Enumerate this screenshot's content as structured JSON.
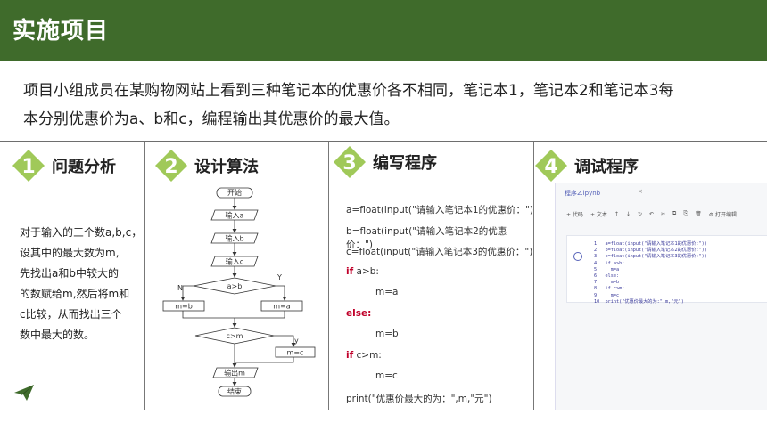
{
  "header": {
    "title": "实施项目"
  },
  "intro": {
    "line1": "项目小组成员在某购物网站上看到三种笔记本的优惠价各不相同，笔记本1，笔记本2和笔记本3每",
    "line2": "本分别优惠价为a、b和c，编程输出其优惠价的最大值。"
  },
  "sections": [
    {
      "number": "1",
      "label": "问题分析"
    },
    {
      "number": "2",
      "label": "设计算法"
    },
    {
      "number": "3",
      "label": "编写程序"
    },
    {
      "number": "4",
      "label": "调试程序"
    }
  ],
  "analysis": {
    "lines": [
      "对于输入的三个数a,b,c，",
      "设其中的最大数为m,",
      "先找出a和b中较大的",
      "的数赋给m,然后将m和",
      "c比较，从而找出三个",
      "数中最大的数。"
    ]
  },
  "flowchart": {
    "start": "开始",
    "input_a": "输入a",
    "input_b": "输入b",
    "input_c": "输入c",
    "cond1": "a>b",
    "yes1": "Y",
    "no1": "N",
    "assign_b": "m=b",
    "assign_a": "m=a",
    "cond2": "c>m",
    "yes2": "y",
    "assign_c": "m=c",
    "output": "输出m",
    "end": "结束"
  },
  "code": {
    "l1": "a=float(input(\"请输入笔记本1的优惠价：\")",
    "l2": "b=float(input(\"请输入笔记本2的优惠价：\")",
    "l3": "c=float(input(\"请输入笔记本3的优惠价：\")",
    "l4_kw": "if",
    "l4_rest": " a>b:",
    "l5": "m=a",
    "l6_kw": "else:",
    "l7": "m=b",
    "l8_kw": "if",
    "l8_rest": " c>m:",
    "l9": "m=c",
    "l10": "print(\"优惠价最大的为：\",m,\"元\")"
  },
  "notebook": {
    "tab": "程序2.ipynb",
    "close": "×",
    "toolbar": [
      "+ 代码",
      "+ 文本",
      "↑",
      "↓",
      "↻",
      "↶",
      "✂",
      "⧉",
      "⎘",
      "🗑",
      "⚙ 打开编辑"
    ],
    "code": "1   a=float(input(\"请输入笔记本1的优惠价:\"))\n2   b=float(input(\"请输入笔记本2的优惠价:\"))\n3   c=float(input(\"请输入笔记本3的优惠价:\"))\n4   if a>b:\n5     m=a\n6   else:\n7     m=b\n8   if c>m:\n9     m=c\n10  print(\"优惠价最大的为:\",m,\"元\")"
  },
  "colors": {
    "header": "#3f6b2b",
    "badge": "#8fbf3c",
    "keyword": "#c0002a"
  }
}
